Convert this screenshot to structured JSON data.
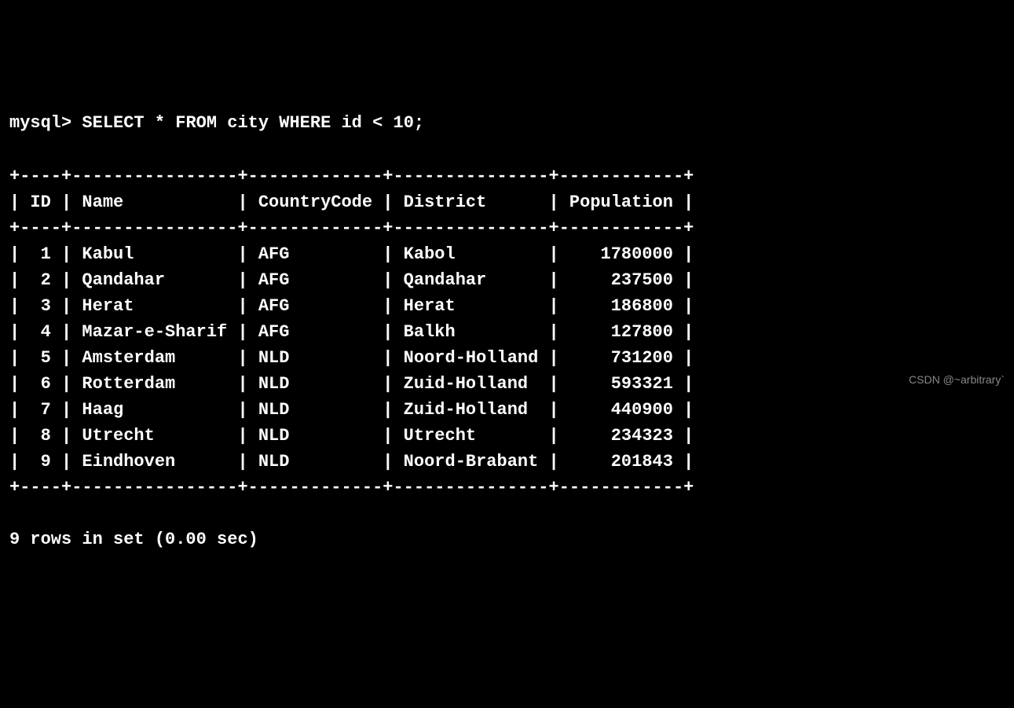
{
  "prompt": "mysql> ",
  "query": "SELECT * FROM city WHERE id < 10;",
  "columns": [
    "ID",
    "Name",
    "CountryCode",
    "District",
    "Population"
  ],
  "rows": [
    {
      "id": 1,
      "name": "Kabul",
      "country_code": "AFG",
      "district": "Kabol",
      "population": 1780000
    },
    {
      "id": 2,
      "name": "Qandahar",
      "country_code": "AFG",
      "district": "Qandahar",
      "population": 237500
    },
    {
      "id": 3,
      "name": "Herat",
      "country_code": "AFG",
      "district": "Herat",
      "population": 186800
    },
    {
      "id": 4,
      "name": "Mazar-e-Sharif",
      "country_code": "AFG",
      "district": "Balkh",
      "population": 127800
    },
    {
      "id": 5,
      "name": "Amsterdam",
      "country_code": "NLD",
      "district": "Noord-Holland",
      "population": 731200
    },
    {
      "id": 6,
      "name": "Rotterdam",
      "country_code": "NLD",
      "district": "Zuid-Holland",
      "population": 593321
    },
    {
      "id": 7,
      "name": "Haag",
      "country_code": "NLD",
      "district": "Zuid-Holland",
      "population": 440900
    },
    {
      "id": 8,
      "name": "Utrecht",
      "country_code": "NLD",
      "district": "Utrecht",
      "population": 234323
    },
    {
      "id": 9,
      "name": "Eindhoven",
      "country_code": "NLD",
      "district": "Noord-Brabant",
      "population": 201843
    }
  ],
  "footer": "9 rows in set (0.00 sec)",
  "watermark": "CSDN @~arbitrary`",
  "chart_data": {
    "type": "table",
    "title": "city table query result",
    "columns": [
      "ID",
      "Name",
      "CountryCode",
      "District",
      "Population"
    ],
    "data": [
      [
        1,
        "Kabul",
        "AFG",
        "Kabol",
        1780000
      ],
      [
        2,
        "Qandahar",
        "AFG",
        "Qandahar",
        237500
      ],
      [
        3,
        "Herat",
        "AFG",
        "Herat",
        186800
      ],
      [
        4,
        "Mazar-e-Sharif",
        "AFG",
        "Balkh",
        127800
      ],
      [
        5,
        "Amsterdam",
        "NLD",
        "Noord-Holland",
        731200
      ],
      [
        6,
        "Rotterdam",
        "NLD",
        "Zuid-Holland",
        593321
      ],
      [
        7,
        "Haag",
        "NLD",
        "Zuid-Holland",
        440900
      ],
      [
        8,
        "Utrecht",
        "NLD",
        "Utrecht",
        234323
      ],
      [
        9,
        "Eindhoven",
        "NLD",
        "Noord-Brabant",
        201843
      ]
    ]
  }
}
